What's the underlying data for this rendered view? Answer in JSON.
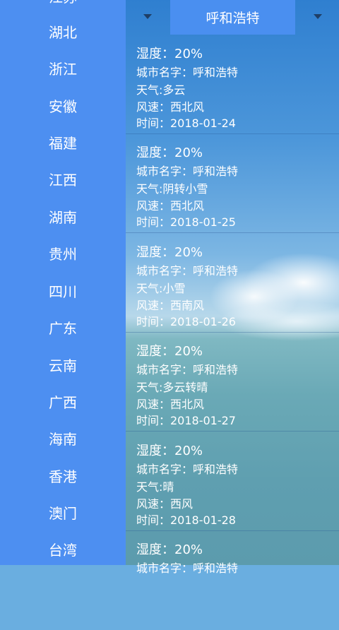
{
  "sidebar": {
    "items": [
      {
        "label": "江苏"
      },
      {
        "label": "湖北"
      },
      {
        "label": "浙江"
      },
      {
        "label": "安徽"
      },
      {
        "label": "福建"
      },
      {
        "label": "江西"
      },
      {
        "label": "湖南"
      },
      {
        "label": "贵州"
      },
      {
        "label": "四川"
      },
      {
        "label": "广东"
      },
      {
        "label": "云南"
      },
      {
        "label": "广西"
      },
      {
        "label": "海南"
      },
      {
        "label": "香港"
      },
      {
        "label": "澳门"
      },
      {
        "label": "台湾"
      }
    ]
  },
  "topbar": {
    "city_selected": "呼和浩特"
  },
  "forecasts": [
    {
      "humidity": "湿度：20%",
      "city": "城市名字：呼和浩特",
      "weather": "天气:多云",
      "wind": "风速：西北风",
      "date": "时间：2018-01-24"
    },
    {
      "humidity": "湿度：20%",
      "city": "城市名字：呼和浩特",
      "weather": "天气:阴转小雪",
      "wind": "风速：西北风",
      "date": "时间：2018-01-25"
    },
    {
      "humidity": "湿度：20%",
      "city": "城市名字：呼和浩特",
      "weather": "天气:小雪",
      "wind": "风速：西南风",
      "date": "时间：2018-01-26"
    },
    {
      "humidity": "湿度：20%",
      "city": "城市名字：呼和浩特",
      "weather": "天气:多云转晴",
      "wind": "风速：西北风",
      "date": "时间：2018-01-27"
    },
    {
      "humidity": "湿度：20%",
      "city": "城市名字：呼和浩特",
      "weather": "天气:晴",
      "wind": "风速：西风",
      "date": "时间：2018-01-28"
    },
    {
      "humidity": "湿度：20%",
      "city": "城市名字：呼和浩特"
    }
  ]
}
